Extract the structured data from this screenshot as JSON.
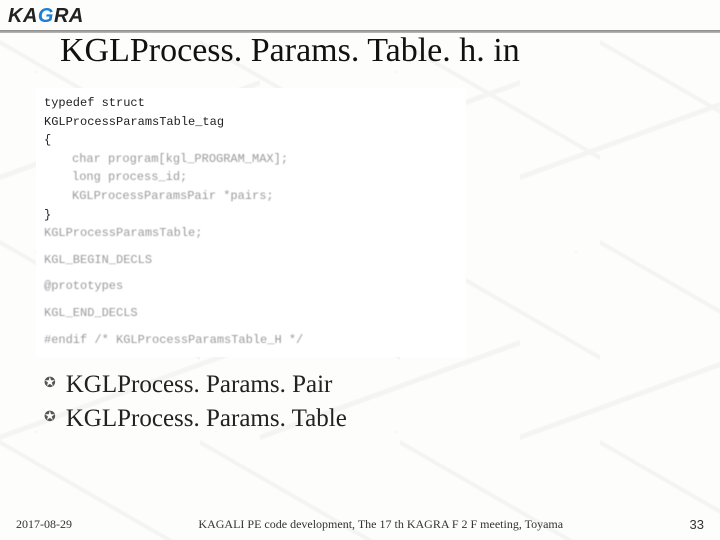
{
  "logo": {
    "pre": "KA",
    "g": "G",
    "post": "RA"
  },
  "title": "KGLProcess. Params. Table. h. in",
  "code": {
    "l1": "typedef struct",
    "l2": "KGLProcessParamsTable_tag",
    "l3": "{",
    "l4": "char program[kgl_PROGRAM_MAX];",
    "l5": "long process_id;",
    "l6": "KGLProcessParamsPair *pairs;",
    "l7": "}",
    "l8": "KGLProcessParamsTable;",
    "l9": "KGL_BEGIN_DECLS",
    "l10": "@prototypes",
    "l11": "KGL_END_DECLS",
    "l12": "#endif  /* KGLProcessParamsTable_H */"
  },
  "bullets": {
    "b1": "KGLProcess. Params. Pair",
    "b2": "KGLProcess. Params. Table"
  },
  "footer": {
    "date": "2017-08-29",
    "center": "KAGALI PE code development, The 17 th KAGRA F 2 F meeting, Toyama",
    "page": "33"
  }
}
